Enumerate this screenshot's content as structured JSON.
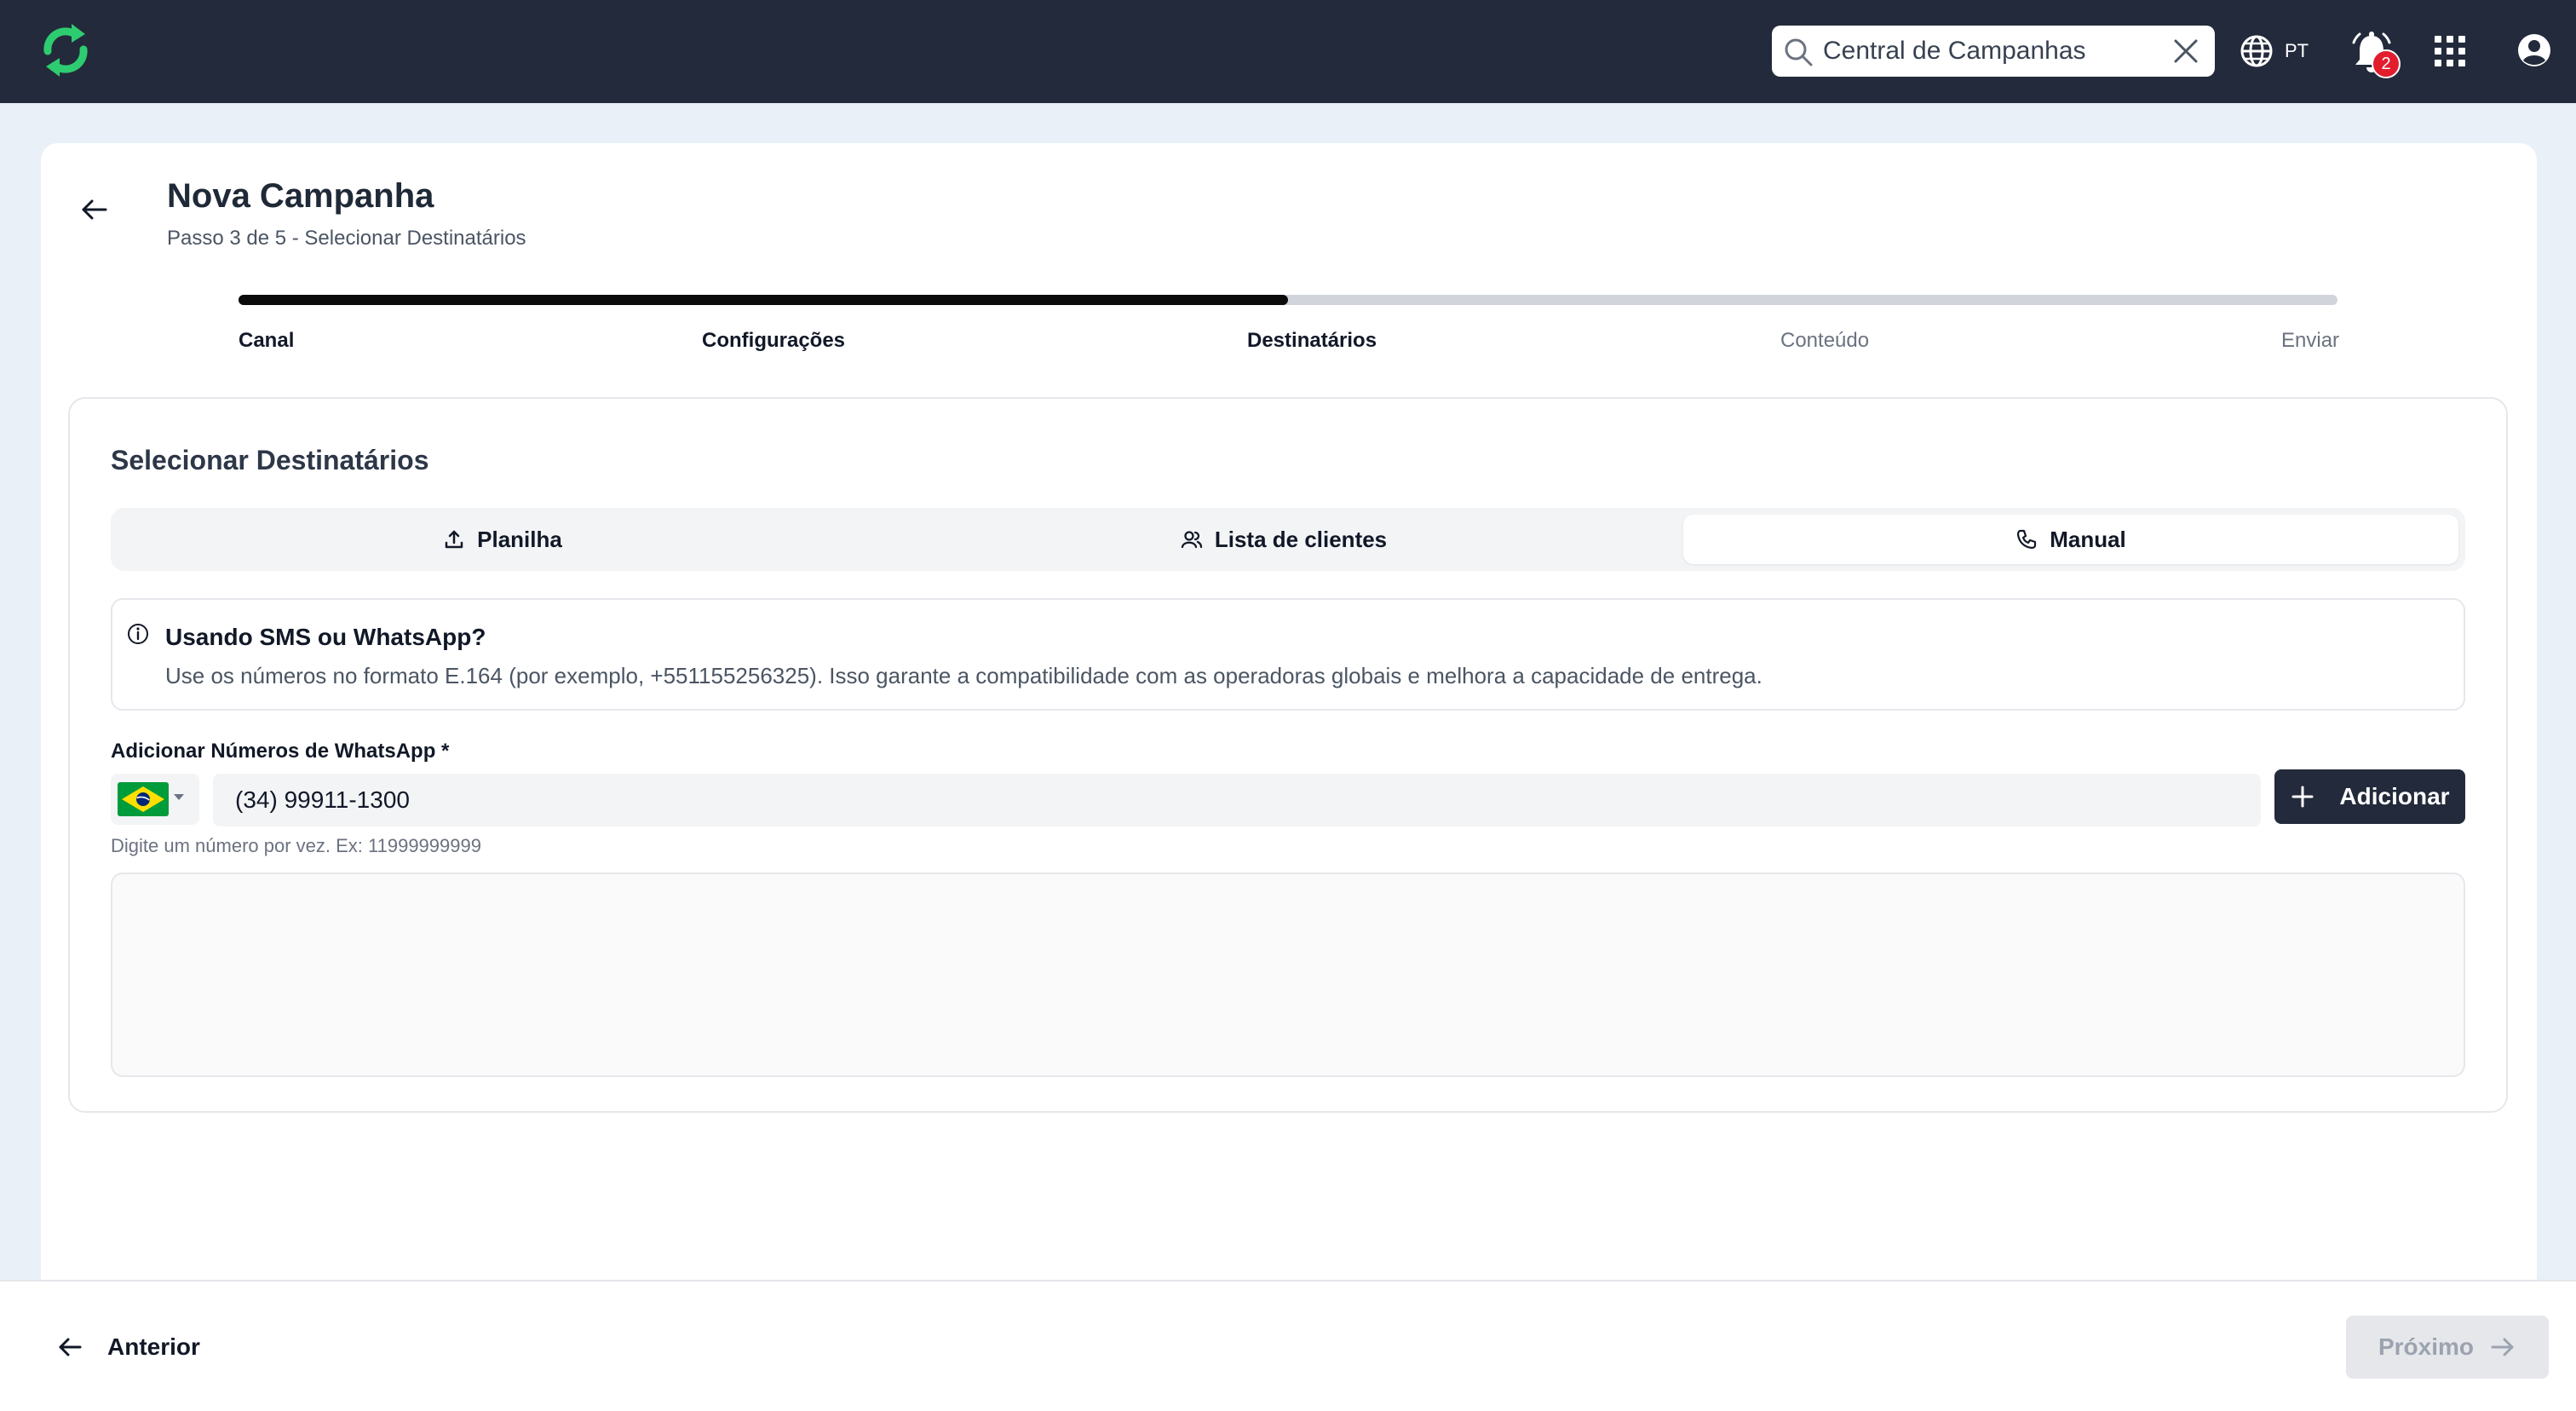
{
  "header": {
    "search_value": "Central de Campanhas",
    "language": "PT",
    "notification_count": "2"
  },
  "page": {
    "title": "Nova Campanha",
    "subtitle": "Passo 3 de 5 - Selecionar Destinatários"
  },
  "stepper": {
    "progress_fraction": 0.5,
    "steps": [
      {
        "label": "Canal",
        "state": "done"
      },
      {
        "label": "Configurações",
        "state": "done"
      },
      {
        "label": "Destinatários",
        "state": "current"
      },
      {
        "label": "Conteúdo",
        "state": "todo"
      },
      {
        "label": "Enviar",
        "state": "todo"
      }
    ]
  },
  "section": {
    "title": "Selecionar Destinatários",
    "tabs": [
      {
        "label": "Planilha",
        "icon": "upload-icon",
        "active": false
      },
      {
        "label": "Lista de clientes",
        "icon": "users-icon",
        "active": false
      },
      {
        "label": "Manual",
        "icon": "phone-icon",
        "active": true
      }
    ],
    "alert": {
      "icon": "info-icon",
      "title": "Usando SMS ou WhatsApp?",
      "body": "Use os números no formato E.164 (por exemplo, +551155256325). Isso garante a compatibilidade com as operadoras globais e melhora a capacidade de entrega."
    },
    "field": {
      "label": "Adicionar Números de WhatsApp *",
      "country_flag": "brazil-flag",
      "value": "(34) 99911-1300",
      "hint": "Digite um número por vez. Ex: 11999999999",
      "add_label": "Adicionar"
    }
  },
  "footer": {
    "prev_label": "Anterior",
    "next_label": "Próximo"
  },
  "colors": {
    "topbar": "#232a3b",
    "accent_green": "#2ecc71",
    "progress": "#0b0b0b",
    "badge": "#e11d2e"
  }
}
